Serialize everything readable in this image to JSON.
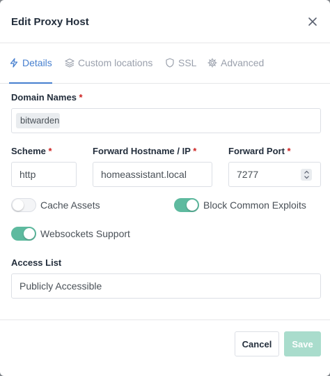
{
  "modal": {
    "title": "Edit Proxy Host"
  },
  "tabs": [
    {
      "label": "Details",
      "icon": "lightning-icon",
      "active": true
    },
    {
      "label": "Custom locations",
      "icon": "layers-icon",
      "active": false
    },
    {
      "label": "SSL",
      "icon": "shield-icon",
      "active": false
    },
    {
      "label": "Advanced",
      "icon": "gear-icon",
      "active": false
    }
  ],
  "form": {
    "domain_names": {
      "label": "Domain Names",
      "required_mark": "*",
      "chip": "bitwarden.c"
    },
    "scheme": {
      "label": "Scheme",
      "required_mark": "*",
      "value": "http"
    },
    "forward_host": {
      "label": "Forward Hostname / IP",
      "required_mark": "*",
      "value": "homeassistant.local"
    },
    "forward_port": {
      "label": "Forward Port",
      "required_mark": "*",
      "value": "7277"
    },
    "cache_assets": {
      "label": "Cache Assets",
      "enabled": false
    },
    "block_exploits": {
      "label": "Block Common Exploits",
      "enabled": true
    },
    "websockets": {
      "label": "Websockets Support",
      "enabled": true
    },
    "access_list": {
      "label": "Access List",
      "value": "Publicly Accessible"
    }
  },
  "footer": {
    "cancel_label": "Cancel",
    "save_label": "Save"
  },
  "colors": {
    "accent": "#467fcf",
    "toggle_on": "#5eba9f",
    "save_button": "#a9dccc",
    "required": "#cd201f"
  }
}
